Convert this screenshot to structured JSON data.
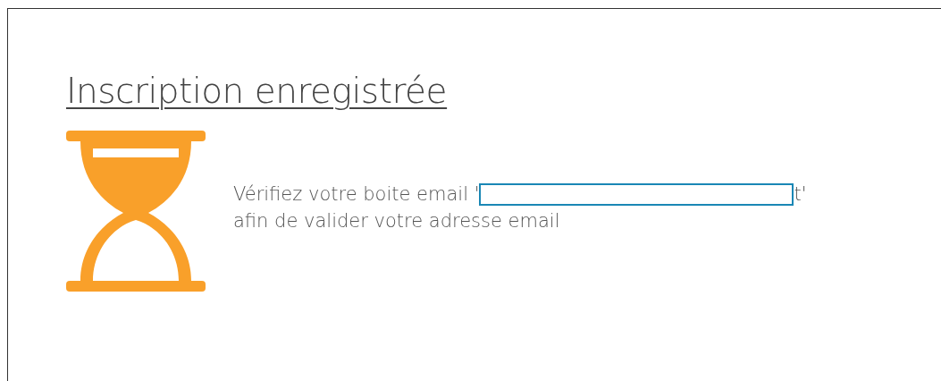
{
  "title": "Inscription enregistrée",
  "message": {
    "before": "Vérifiez votre boite email '",
    "after": "t'",
    "line_2": "afin de valider votre adresse email"
  }
}
